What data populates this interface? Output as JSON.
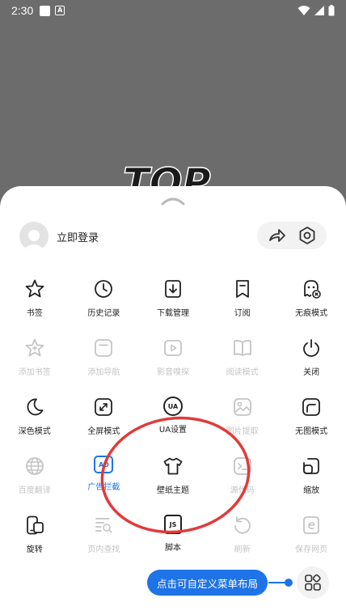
{
  "status_bar": {
    "time": "2:30"
  },
  "background": {
    "art_text": "TOP"
  },
  "sheet": {
    "login_label": "立即登录",
    "menu_items": [
      {
        "label": "书签",
        "icon": "star-icon",
        "enabled": true
      },
      {
        "label": "历史记录",
        "icon": "clock-icon",
        "enabled": true
      },
      {
        "label": "下载管理",
        "icon": "download-icon",
        "enabled": true
      },
      {
        "label": "订阅",
        "icon": "bookmark-icon",
        "enabled": true
      },
      {
        "label": "无痕模式",
        "icon": "ghost-icon",
        "enabled": true
      },
      {
        "label": "添加书签",
        "icon": "star-add-icon",
        "enabled": false
      },
      {
        "label": "添加导航",
        "icon": "add-nav-icon",
        "enabled": false
      },
      {
        "label": "影音嗅探",
        "icon": "play-icon",
        "enabled": false
      },
      {
        "label": "阅读模式",
        "icon": "book-icon",
        "enabled": false
      },
      {
        "label": "关闭",
        "icon": "power-icon",
        "enabled": true
      },
      {
        "label": "深色模式",
        "icon": "moon-icon",
        "enabled": true
      },
      {
        "label": "全屏模式",
        "icon": "fullscreen-icon",
        "enabled": true
      },
      {
        "label": "UA设置",
        "icon": "ua-icon",
        "enabled": true
      },
      {
        "label": "图片提取",
        "icon": "image-icon",
        "enabled": false
      },
      {
        "label": "无图模式",
        "icon": "no-image-icon",
        "enabled": true
      },
      {
        "label": "百度翻译",
        "icon": "globe-icon",
        "enabled": false
      },
      {
        "label": "广告拦截",
        "icon": "ad-block-icon",
        "enabled": true
      },
      {
        "label": "壁纸主题",
        "icon": "tshirt-icon",
        "enabled": true
      },
      {
        "label": "源代码",
        "icon": "terminal-icon",
        "enabled": false
      },
      {
        "label": "缩放",
        "icon": "zoom-icon",
        "enabled": true
      },
      {
        "label": "旋转",
        "icon": "rotate-icon",
        "enabled": true
      },
      {
        "label": "页内查找",
        "icon": "find-in-page-icon",
        "enabled": false
      },
      {
        "label": "脚本",
        "icon": "js-icon",
        "enabled": true
      },
      {
        "label": "刷新",
        "icon": "refresh-icon",
        "enabled": false
      },
      {
        "label": "保存网页",
        "icon": "save-page-icon",
        "enabled": false
      }
    ],
    "tooltip": "点击可自定义菜单布局"
  },
  "colors": {
    "accent": "#1e73e8",
    "annotation": "#e23a3a",
    "disabled": "#c4c4c4"
  }
}
